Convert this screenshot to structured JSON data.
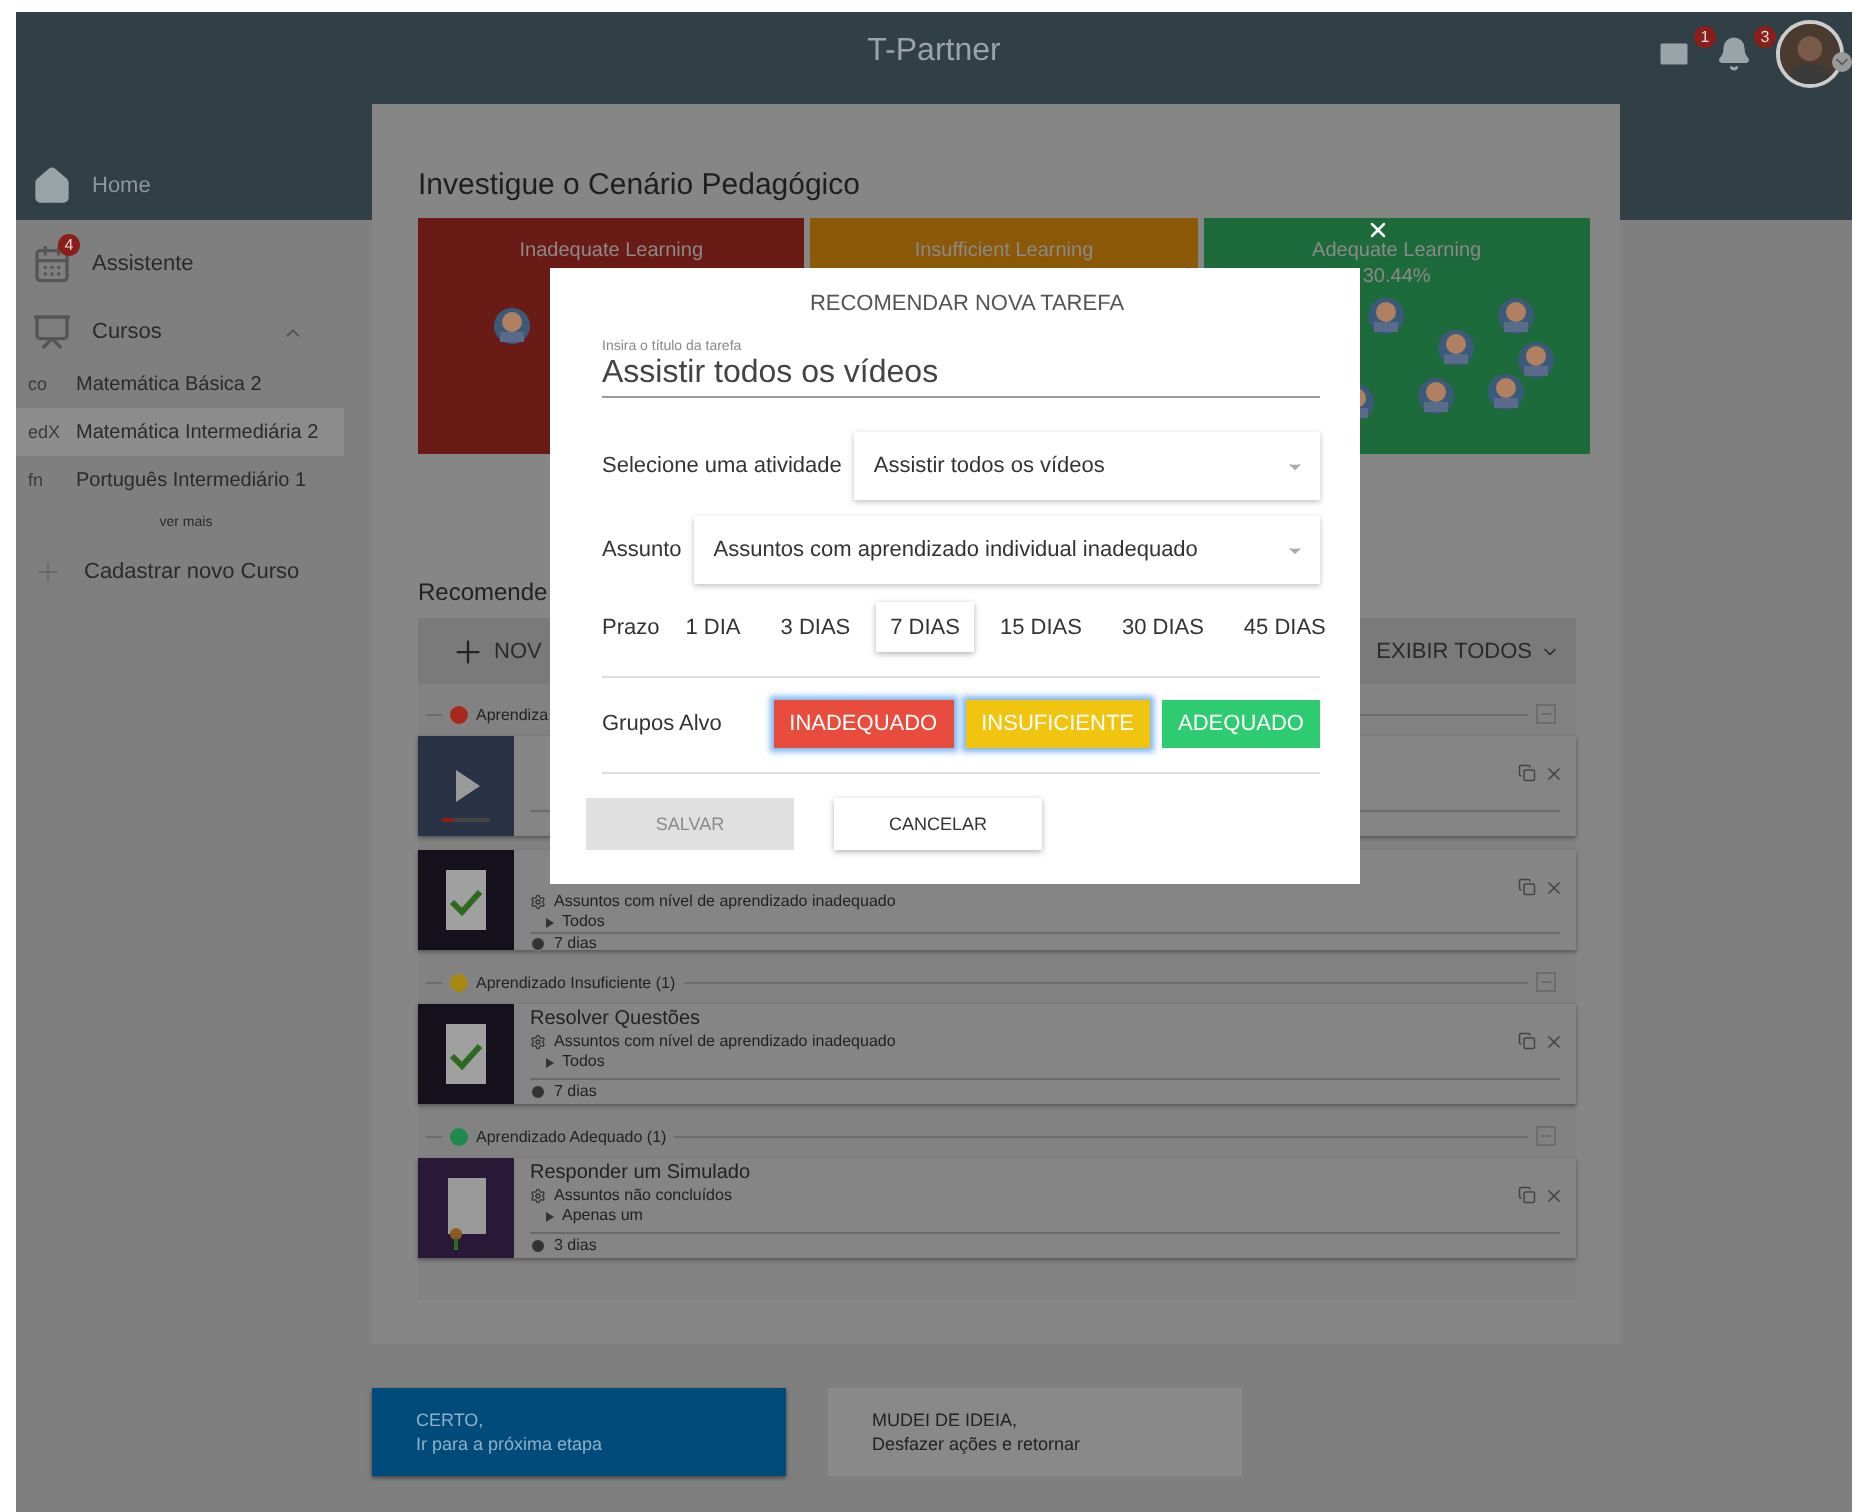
{
  "app": {
    "title": "T-Partner"
  },
  "header": {
    "mail_badge": "1",
    "bell_badge": "3"
  },
  "sidebar": {
    "home": "Home",
    "assistant": {
      "label": "Assistente",
      "badge": "4"
    },
    "courses": {
      "label": "Cursos",
      "expanded": true,
      "items": [
        {
          "logo": "co",
          "label": "Matemática Básica 2",
          "selected": false
        },
        {
          "logo": "edX",
          "label": "Matemática Intermediária 2",
          "selected": true
        },
        {
          "logo": "fn",
          "label": "Português Intermediário 1",
          "selected": false
        }
      ],
      "more": "ver mais"
    },
    "add": "Cadastrar novo Curso"
  },
  "main": {
    "title": "Investigue o Cenário Pedagógico",
    "tiles": [
      {
        "label": "Inadequate Learning",
        "color": "#6a1b15"
      },
      {
        "label": "Insufficient Learning",
        "color": "#8a5806"
      },
      {
        "label": "Adequate Learning",
        "value": "30.44%",
        "color": "#1d6a3a"
      }
    ],
    "recommend": {
      "title": "Recomende",
      "new_label": "NOV",
      "show_all": "EXIBIR TODOS",
      "groups": [
        {
          "label": "Aprendiza",
          "color": "#a8281f",
          "cards": [
            {
              "kind": "video"
            },
            {
              "kind": "checklist",
              "subject": "Assuntos com nível de aprendizado inadequado",
              "scope": "Todos",
              "deadline": "7 dias"
            }
          ]
        },
        {
          "label": "Aprendizado Insuficiente (1)",
          "color": "#a68812",
          "cards": [
            {
              "kind": "checklist",
              "title": "Resolver Questões",
              "subject": "Assuntos com nível de aprendizado inadequado",
              "scope": "Todos",
              "deadline": "7 dias"
            }
          ]
        },
        {
          "label": "Aprendizado Adequado (1)",
          "color": "#1f8a4c",
          "cards": [
            {
              "kind": "certificate",
              "title": "Responder um Simulado",
              "subject": "Assuntos não concluídos",
              "scope": "Apenas um",
              "deadline": "3 dias"
            }
          ]
        }
      ]
    }
  },
  "footer_buttons": [
    {
      "kind": "primary",
      "line1": "CERTO,",
      "line2": "Ir para a próxima etapa"
    },
    {
      "kind": "secondary",
      "line1": "MUDEI DE IDEIA,",
      "line2": "Desfazer ações e retornar"
    }
  ],
  "modal": {
    "title": "RECOMENDAR NOVA TAREFA",
    "title_field": {
      "label": "Insira o título da tarefa",
      "value": "Assistir todos os vídeos"
    },
    "activity": {
      "label": "Selecione uma atividade",
      "value": "Assistir todos os vídeos"
    },
    "subject": {
      "label": "Assunto",
      "value": "Assuntos com aprendizado individual inadequado"
    },
    "deadline": {
      "label": "Prazo",
      "options": [
        {
          "label": "1 DIA",
          "selected": false
        },
        {
          "label": "3 DIAS",
          "selected": false
        },
        {
          "label": "7 DIAS",
          "selected": true
        },
        {
          "label": "15 DIAS",
          "selected": false
        },
        {
          "label": "30 DIAS",
          "selected": false
        },
        {
          "label": "45 DIAS",
          "selected": false
        }
      ]
    },
    "groups": {
      "label": "Grupos Alvo",
      "options": [
        {
          "label": "INADEQUADO",
          "color": "#e74c3c",
          "selected": true
        },
        {
          "label": "INSUFICIENTE",
          "color": "#f1c40f",
          "selected": true
        },
        {
          "label": "ADEQUADO",
          "color": "#2ecc71",
          "selected": false
        }
      ]
    },
    "buttons": [
      {
        "kind": "primary",
        "label": "SALVAR",
        "disabled": true
      },
      {
        "kind": "secondary",
        "label": "CANCELAR",
        "disabled": false
      }
    ]
  }
}
